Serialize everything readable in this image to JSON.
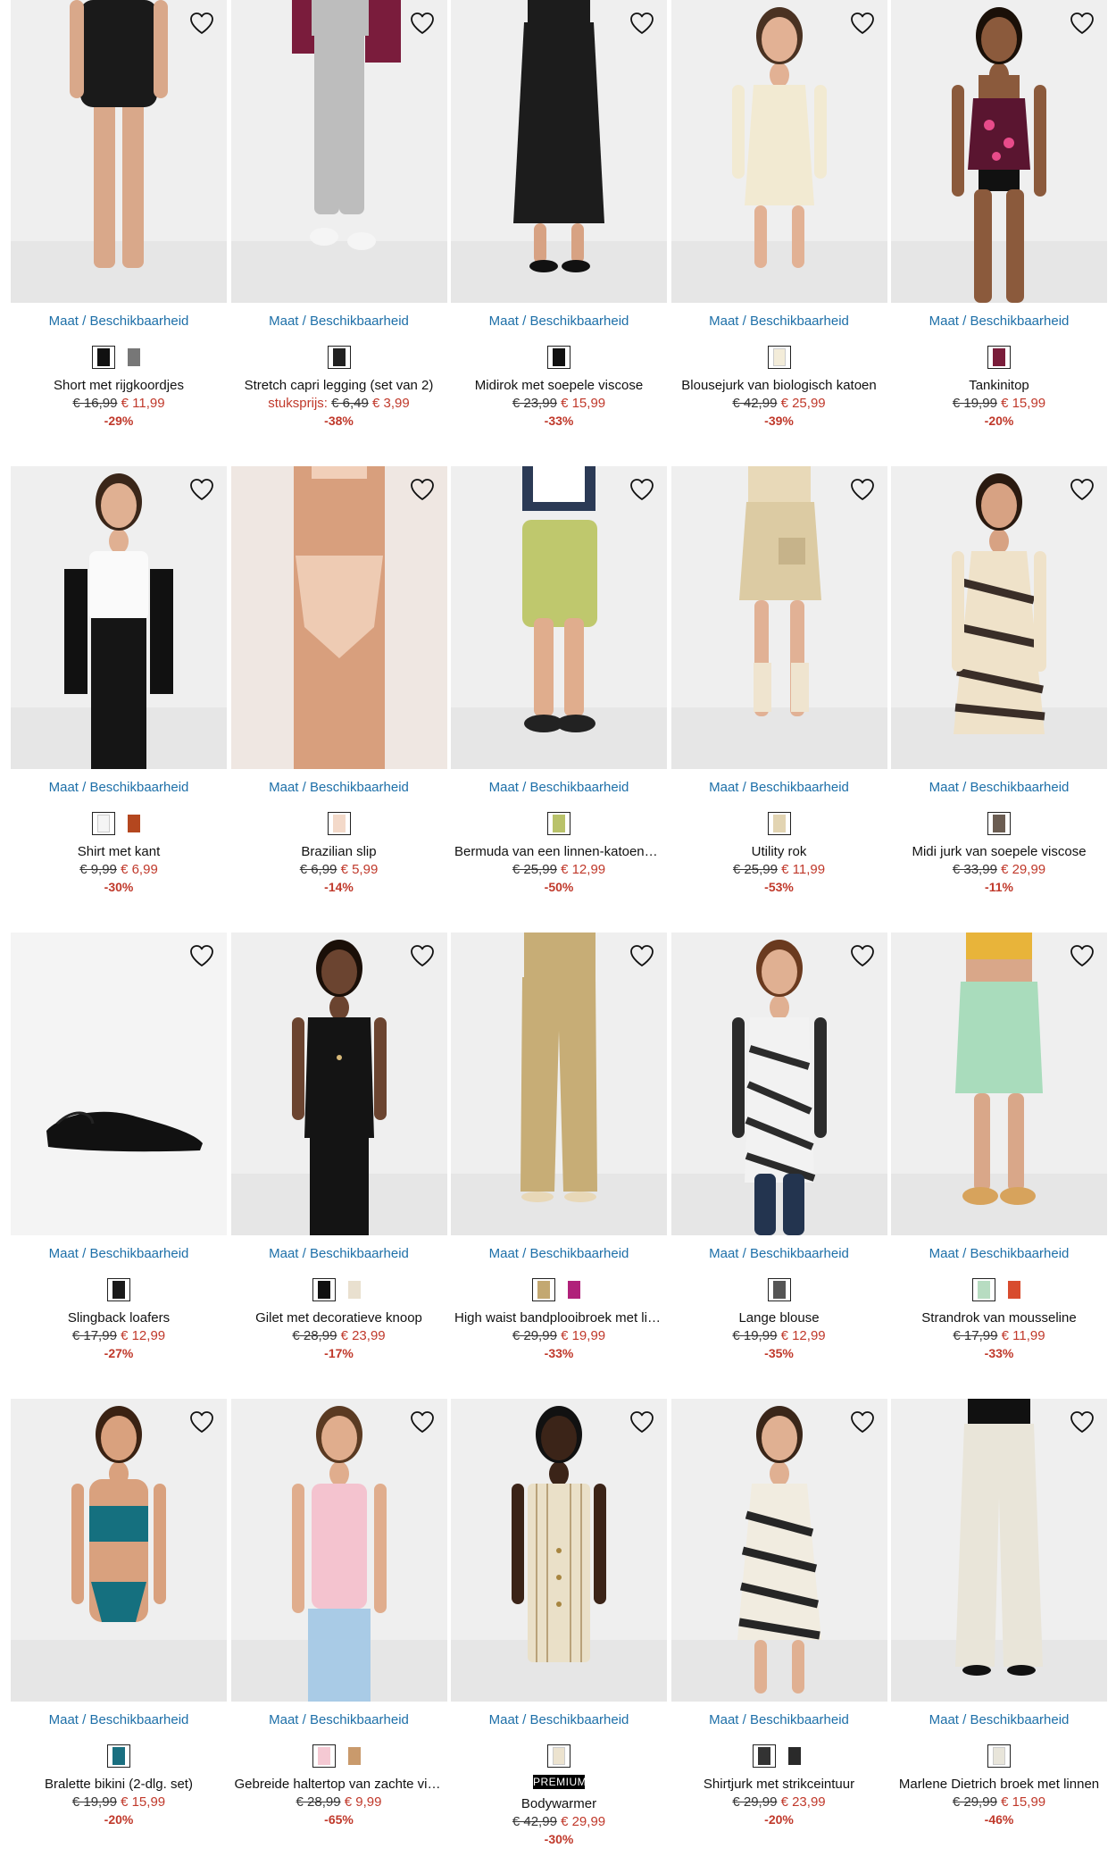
{
  "products": [
    {
      "name": "Short met rijgkoordjes",
      "old": "€ 16,99",
      "new": "€ 11,99",
      "discount": "-29%",
      "link": "Maat / Beschikbaarheid",
      "colors": [
        "#111111",
        "#777777"
      ],
      "fig": "shorts-black",
      "fig_color": "#1a1a1a",
      "skin": "#d9a88a"
    },
    {
      "name": "Stretch capri legging (set van 2)",
      "unit": "stuksprijs:",
      "old": "€ 6,49",
      "new": "€ 3,99",
      "discount": "-38%",
      "link": "Maat / Beschikbaarheid",
      "colors": [
        "#222222"
      ],
      "fig": "legging",
      "fig_color": "#bdbdbd",
      "skin": "#e3b598"
    },
    {
      "name": "Midirok met soepele viscose",
      "old": "€ 23,99",
      "new": "€ 15,99",
      "discount": "-33%",
      "link": "Maat / Beschikbaarheid",
      "colors": [
        "#111111"
      ],
      "fig": "skirt-long",
      "fig_color": "#1c1c1c",
      "skin": "#d7a283"
    },
    {
      "name": "Blousejurk van biologisch katoen",
      "old": "€ 42,99",
      "new": "€ 25,99",
      "discount": "-39%",
      "link": "Maat / Beschikbaarheid",
      "colors": [
        "#f3ecd9"
      ],
      "fig": "dress-cream",
      "fig_color": "#f2ead2",
      "skin": "#e2b194"
    },
    {
      "name": "Tankinitop",
      "old": "€ 19,99",
      "new": "€ 15,99",
      "discount": "-20%",
      "link": "Maat / Beschikbaarheid",
      "colors": [
        "#7a1d3a"
      ],
      "fig": "tankini",
      "fig_color": "#5a1530",
      "skin": "#8b5a3c"
    },
    {
      "name": "Shirt met kant",
      "old": "€ 9,99",
      "new": "€ 6,99",
      "discount": "-30%",
      "link": "Maat / Beschikbaarheid",
      "colors": [
        "#f5f5f5",
        "#b4471f"
      ],
      "fig": "shirt-white",
      "fig_color": "#fafafa",
      "skin": "#e0b092"
    },
    {
      "name": "Brazilian slip",
      "old": "€ 6,99",
      "new": "€ 5,99",
      "discount": "-14%",
      "link": "Maat / Beschikbaarheid",
      "colors": [
        "#f3d9c9"
      ],
      "fig": "slip",
      "fig_color": "#f1cfb9",
      "skin": "#d89f7d"
    },
    {
      "name": "Bermuda van een linnen-katoenmix",
      "old": "€ 25,99",
      "new": "€ 12,99",
      "discount": "-50%",
      "link": "Maat / Beschikbaarheid",
      "colors": [
        "#b9c26a"
      ],
      "fig": "bermuda",
      "fig_color": "#bfc86d",
      "skin": "#e0ad8d"
    },
    {
      "name": "Utility rok",
      "old": "€ 25,99",
      "new": "€ 11,99",
      "discount": "-53%",
      "link": "Maat / Beschikbaarheid",
      "colors": [
        "#e2d4b2"
      ],
      "fig": "utility-skirt",
      "fig_color": "#dccba3",
      "skin": "#e1b195"
    },
    {
      "name": "Midi jurk van soepele viscose",
      "old": "€ 33,99",
      "new": "€ 29,99",
      "discount": "-11%",
      "link": "Maat / Beschikbaarheid",
      "colors": [
        "#6b5d52"
      ],
      "fig": "zebra-dress",
      "fig_color": "#3a2e28",
      "skin": "#d7a283"
    },
    {
      "name": "Slingback loafers",
      "old": "€ 17,99",
      "new": "€ 12,99",
      "discount": "-27%",
      "link": "Maat / Beschikbaarheid",
      "colors": [
        "#1a1a1a"
      ],
      "fig": "loafer",
      "fig_color": "#111111",
      "skin": "#e0b092"
    },
    {
      "name": "Gilet met decoratieve knoop",
      "old": "€ 28,99",
      "new": "€ 23,99",
      "discount": "-17%",
      "link": "Maat / Beschikbaarheid",
      "colors": [
        "#111111",
        "#e9e0cf"
      ],
      "fig": "gilet",
      "fig_color": "#141414",
      "skin": "#6b4430"
    },
    {
      "name": "High waist bandplooibroek met linn…",
      "old": "€ 29,99",
      "new": "€ 19,99",
      "discount": "-33%",
      "link": "Maat / Beschikbaarheid",
      "colors": [
        "#c3a871",
        "#b0217a"
      ],
      "fig": "trousers-khaki",
      "fig_color": "#c7ad76",
      "skin": "#e0b092"
    },
    {
      "name": "Lange blouse",
      "old": "€ 19,99",
      "new": "€ 12,99",
      "discount": "-35%",
      "link": "Maat / Beschikbaarheid",
      "colors": [
        "#555555"
      ],
      "fig": "blouse-stripe",
      "fig_color": "#2b2b2b",
      "skin": "#e0b092"
    },
    {
      "name": "Strandrok van mousseline",
      "old": "€ 17,99",
      "new": "€ 11,99",
      "discount": "-33%",
      "link": "Maat / Beschikbaarheid",
      "colors": [
        "#b7dcc1",
        "#d84c2e"
      ],
      "fig": "beach-skirt",
      "fig_color": "#a9dcbc",
      "skin": "#d9a789"
    },
    {
      "name": "Bralette bikini (2-dlg. set)",
      "old": "€ 19,99",
      "new": "€ 15,99",
      "discount": "-20%",
      "link": "Maat / Beschikbaarheid",
      "colors": [
        "#1a6f80"
      ],
      "fig": "bikini",
      "fig_color": "#15707f",
      "skin": "#d9a17e"
    },
    {
      "name": "Gebreide haltertop van zachte visc…",
      "old": "€ 28,99",
      "new": "€ 9,99",
      "discount": "-65%",
      "link": "Maat / Beschikbaarheid",
      "colors": [
        "#f5c9d3",
        "#c99a6c"
      ],
      "fig": "halter",
      "fig_color": "#f4c3cf",
      "skin": "#e0ad8d"
    },
    {
      "name": "Bodywarmer",
      "badge": "PREMIUM",
      "old": "€ 42,99",
      "new": "€ 29,99",
      "discount": "-30%",
      "link": "Maat / Beschikbaarheid",
      "colors": [
        "#ece3cf"
      ],
      "fig": "bodywarmer",
      "fig_color": "#eae0c8",
      "skin": "#3b2418"
    },
    {
      "name": "Shirtjurk met strikceintuur",
      "old": "€ 29,99",
      "new": "€ 23,99",
      "discount": "-20%",
      "link": "Maat / Beschikbaarheid",
      "colors": [
        "#333333",
        "#2a2a2a"
      ],
      "fig": "shirt-dress",
      "fig_color": "#262626",
      "skin": "#e0b092"
    },
    {
      "name": "Marlene Dietrich broek met linnen",
      "old": "€ 29,99",
      "new": "€ 15,99",
      "discount": "-46%",
      "link": "Maat / Beschikbaarheid",
      "colors": [
        "#e8e5da"
      ],
      "fig": "marlene",
      "fig_color": "#e9e5d9",
      "skin": "#e0b092"
    }
  ]
}
